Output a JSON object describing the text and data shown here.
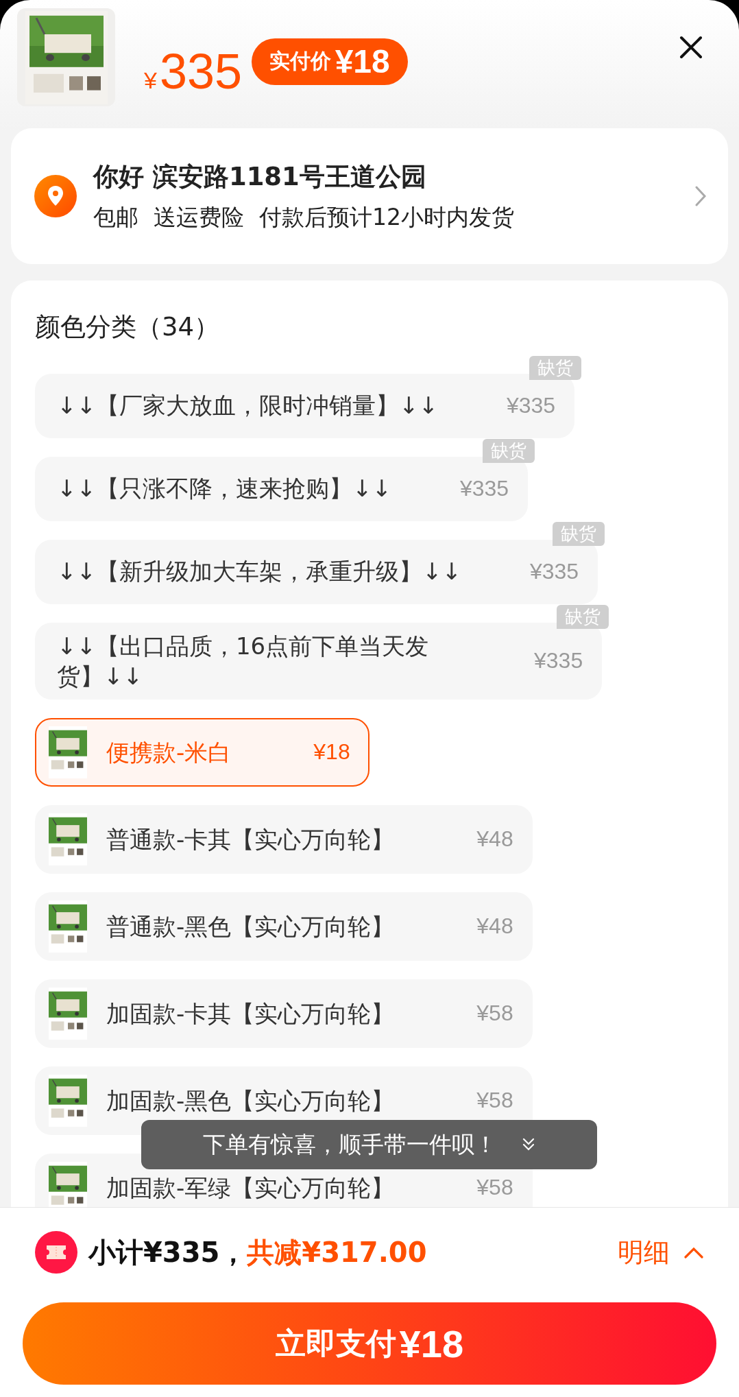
{
  "header": {
    "price": {
      "currency": "¥",
      "amount": "335"
    },
    "badge": {
      "label": "实付价",
      "amount": "¥18"
    }
  },
  "address": {
    "title": "你好 滨安路1181号王道公园",
    "notes": [
      "包邮",
      "送运费险",
      "付款后预计12小时内发货"
    ]
  },
  "options": {
    "heading": "颜色分类（34）",
    "items": [
      {
        "kind": "text",
        "label": "↓↓【厂家大放血，限时冲销量】↓↓",
        "price": "¥335",
        "badge": "缺货",
        "selected": false
      },
      {
        "kind": "text",
        "label": "↓↓【只涨不降，速来抢购】↓↓",
        "price": "¥335",
        "badge": "缺货",
        "selected": false
      },
      {
        "kind": "text",
        "label": "↓↓【新升级加大车架，承重升级】↓↓",
        "price": "¥335",
        "badge": "缺货",
        "selected": false
      },
      {
        "kind": "text",
        "label": "↓↓【出口品质，16点前下单当天发货】↓↓",
        "price": "¥335",
        "badge": "缺货",
        "selected": false
      },
      {
        "label": "便携款-米白",
        "price": "¥18",
        "selected": true
      },
      {
        "label": "普通款-卡其【实心万向轮】",
        "price": "¥48",
        "selected": false
      },
      {
        "label": "普通款-黑色【实心万向轮】",
        "price": "¥48",
        "selected": false
      },
      {
        "label": "加固款-卡其【实心万向轮】",
        "price": "¥58",
        "selected": false
      },
      {
        "label": "加固款-黑色【实心万向轮】",
        "price": "¥58",
        "selected": false
      },
      {
        "label": "加固款-军绿【实心万向轮】",
        "price": "¥58",
        "selected": false
      }
    ]
  },
  "toast": {
    "text": "下单有惊喜，顺手带一件呗！"
  },
  "summary": {
    "subtotal": "小计¥335，",
    "discount": "共减¥317.00",
    "details": "明细"
  },
  "pay_button": {
    "label": "立即支付",
    "amount": "¥18"
  }
}
